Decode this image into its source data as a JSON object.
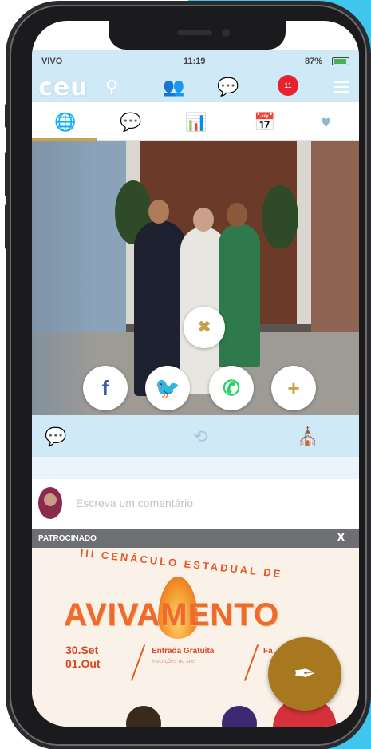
{
  "status_bar": {
    "carrier": "VIVO",
    "time": "11:19",
    "battery": "87%"
  },
  "header": {
    "logo": "ceu",
    "notification_count": "11"
  },
  "tabs": [
    {
      "icon": "globe-icon"
    },
    {
      "icon": "chat-bubbles-icon"
    },
    {
      "icon": "bar-chart-icon"
    },
    {
      "icon": "calendar-icon"
    },
    {
      "icon": "heart-icon"
    }
  ],
  "share_overlay": {
    "close_label": "✖",
    "facebook_label": "f",
    "twitter_label": "🐦",
    "whatsapp_label": "✆",
    "more_label": "+"
  },
  "comment": {
    "placeholder": "Escreva um comentário"
  },
  "ad": {
    "label": "PATROCINADO",
    "close": "X",
    "arc_text": "III CENÁCULO ESTADUAL DE",
    "title": "AVIVAMENTO",
    "date_line1": "30.Set",
    "date_line2": "01.Out",
    "entry_title": "Entrada Gratuita",
    "entry_subtitle": "Inscrições no site",
    "far_text": "Fa"
  },
  "colors": {
    "accent_bg": "#3fc6ec",
    "header_bg": "#cfe9f7",
    "tab_active": "#caa24c",
    "fab": "#a8781f",
    "notif": "#e4232d"
  }
}
